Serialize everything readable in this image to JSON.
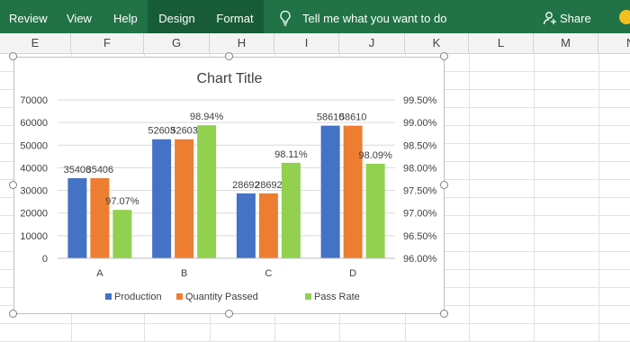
{
  "ribbon": {
    "tabs": [
      "Review",
      "View",
      "Help",
      "Design",
      "Format"
    ],
    "tell_me": "Tell me what you want to do",
    "share": "Share",
    "colors": {
      "ribbon_bg": "#217346",
      "active_tab_bg": "#185c37"
    }
  },
  "columns": [
    "E",
    "F",
    "G",
    "H",
    "I",
    "J",
    "K",
    "L",
    "M",
    "N"
  ],
  "chart_data": {
    "type": "bar",
    "title": "Chart Title",
    "categories": [
      "A",
      "B",
      "C",
      "D"
    ],
    "series": [
      {
        "name": "Production",
        "color": "#4472c4",
        "axis": "primary",
        "values": [
          35406,
          52603,
          28692,
          58610
        ],
        "labels": [
          "35406",
          "52603",
          "28692",
          "58610"
        ]
      },
      {
        "name": "Quantity Passed",
        "color": "#ed7d31",
        "axis": "primary",
        "values": [
          35406,
          52603,
          28692,
          58610
        ],
        "labels": [
          "35406",
          "52603",
          "28692",
          "58610"
        ]
      },
      {
        "name": "Pass Rate",
        "color": "#92d050",
        "axis": "secondary",
        "values": [
          0.9707,
          0.9894,
          0.9811,
          0.9809
        ],
        "labels": [
          "97.07%",
          "98.94%",
          "98.11%",
          "98.09%"
        ]
      }
    ],
    "primary_axis": {
      "min": 0,
      "max": 70000,
      "ticks": [
        "0",
        "10000",
        "20000",
        "30000",
        "40000",
        "50000",
        "60000",
        "70000"
      ]
    },
    "secondary_axis": {
      "min": 0.96,
      "max": 0.995,
      "ticks": [
        "96.00%",
        "96.50%",
        "97.00%",
        "97.50%",
        "98.00%",
        "98.50%",
        "99.00%",
        "99.50%"
      ]
    },
    "grid": true,
    "legend_position": "bottom"
  }
}
